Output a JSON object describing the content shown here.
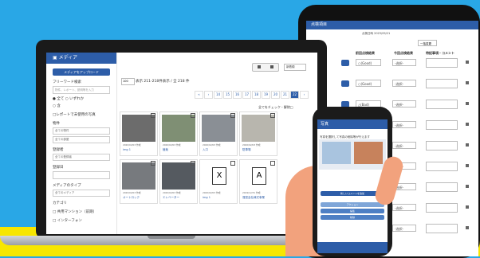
{
  "tablet": {
    "title": "点検項目",
    "date_label": "点検日時 2023/09/21",
    "period_value": "一括変更",
    "col_prev": "前回点検結果",
    "col_curr": "今回点検結果",
    "col_comment": "特記事項・コメント",
    "rows": [
      {
        "prev": "○(Good)",
        "curr": "-选択-"
      },
      {
        "prev": "○(Good)",
        "curr": "-选択-"
      },
      {
        "prev": "△(Bad)",
        "curr": "-选択-"
      },
      {
        "prev": "○(Good)",
        "curr": "-选択-"
      },
      {
        "prev": "○(Good)",
        "curr": "-选択-"
      },
      {
        "prev": "○(Good)",
        "curr": "-选択-"
      },
      {
        "prev": "○(Good)",
        "curr": "-选択-"
      },
      {
        "prev": "○(Good)",
        "curr": "-选択-"
      },
      {
        "prev": "○(Good)",
        "curr": "-选択-"
      }
    ],
    "side_labels": [
      "ン",
      "ン"
    ]
  },
  "sidebar": {
    "title": "メディア",
    "upload_label": "メディアをアップロード",
    "keyword_label": "フリーワード検索",
    "keyword_placeholder": "物件、レポート、説明等を入力",
    "radio_all": "全て",
    "radio_any": "いずれか",
    "radio_and": "含",
    "unused_label": "レポートで未使用の写真",
    "property_label": "物件",
    "property_opt1": "全ての物件",
    "property_opt2": "全ての部屋",
    "registrant_label": "登録者",
    "registrant_opt": "全ての登録者",
    "date_label": "登録日",
    "type_label": "メディアのタイプ",
    "type_opt": "全てのメディア",
    "category_label": "カテゴリ",
    "cat1": "□ 共用マンション（前期）",
    "cat2": "□ インターフォン"
  },
  "main": {
    "sort_value": "新着順",
    "per_page": "100",
    "count_text": "表示 211-218件表示 / 全 218 件",
    "pages": [
      "«",
      "‹",
      "14",
      "15",
      "16",
      "17",
      "18",
      "19",
      "20",
      "21",
      "22",
      "›"
    ],
    "active_page": "22",
    "check_all": "全てをチェック・解除",
    "cards": [
      {
        "date": "2020/02/03 作成",
        "name": "img 1"
      },
      {
        "date": "2020/02/03 作成",
        "name": "植栽"
      },
      {
        "date": "2020/02/03 作成",
        "name": "入口"
      },
      {
        "date": "2020/02/03 作成",
        "name": "駐車場"
      },
      {
        "date": "2020/02/03 作成",
        "name": "オートロック"
      },
      {
        "date": "2020/02/03 作成",
        "name": "エレベーター"
      },
      {
        "date": "2020/02/03 作成",
        "name": "img 1"
      },
      {
        "date": "2019/12/31 作成",
        "name": "運営会社様式事業"
      }
    ]
  },
  "phone": {
    "header": "写真",
    "note": "写真を選択して写真の削除等が行えます",
    "btn1": "新しいコメントを追加",
    "btn2": "アクション",
    "btn3": "編集",
    "btn4": "削除"
  }
}
